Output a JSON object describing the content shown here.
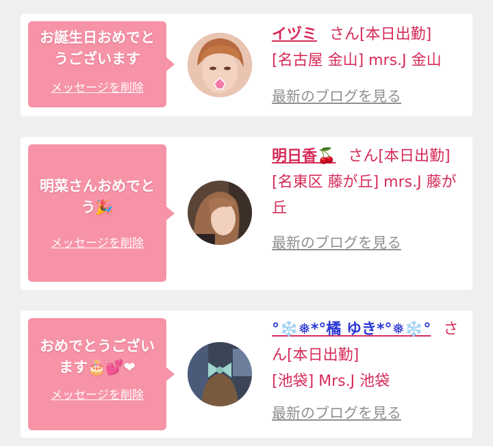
{
  "cards": [
    {
      "message": "お誕生日おめでとうございます",
      "delete_label": "メッセージを削除",
      "name": "イヅミ",
      "honorific": "さん[本日出勤]",
      "shop": "[名古屋 金山] mrs.J 金山",
      "blog_link": "最新のブログを見る"
    },
    {
      "message": "明菜さんおめでとう🎉",
      "delete_label": "メッセージを削除",
      "name": "明日香🍒",
      "honorific": "さん[本日出勤]",
      "shop": "[名東区 藤が丘] mrs.J 藤が丘",
      "blog_link": "最新のブログを見る"
    },
    {
      "message": "おめでとうございます🎂💕❤",
      "delete_label": "メッセージを削除",
      "name": "°❄️❅*°橘 ゆき*°❅❄️°",
      "honorific": "さん[本日出勤]",
      "shop": "[池袋] Mrs.J 池袋",
      "blog_link": "最新のブログを見る"
    }
  ],
  "colors": {
    "page_bg": "#efefef",
    "bubble": "#f793a7",
    "accent": "#d52a57",
    "name_blue": "#2d38d4",
    "link_gray": "#8f8f8f"
  }
}
